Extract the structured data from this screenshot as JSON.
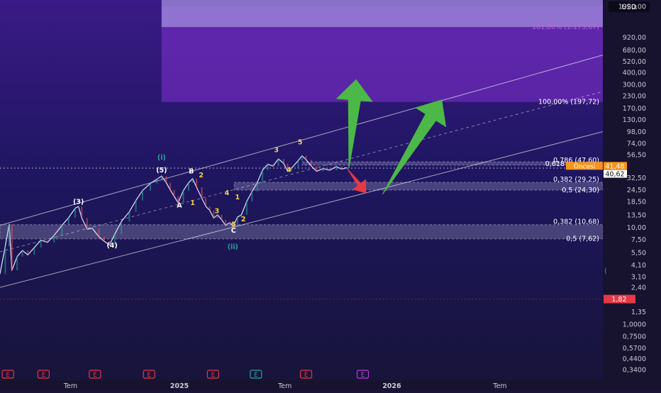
{
  "chart_data": {
    "type": "line",
    "scale": "log",
    "currency": "USD",
    "y_ticks": [
      "1920,00",
      "920,00",
      "680,00",
      "520,00",
      "400,00",
      "300,00",
      "230,00",
      "170,00",
      "130,00",
      "98,00",
      "74,00",
      "56,50",
      "32,50",
      "24,50",
      "18,50",
      "13,50",
      "10,00",
      "7,50",
      "5,50",
      "4,10",
      "3,10",
      "2,40",
      "1,35",
      "1,0000",
      "0,7500",
      "0,5700",
      "0,4400",
      "0,3400"
    ],
    "x_ticks": [
      "Tem",
      "2025",
      "Tem",
      "2026",
      "Tem"
    ],
    "price_badges": [
      {
        "label": "41,48",
        "value": 41.48,
        "color": "#f7931a",
        "sub": "Öncesi"
      },
      {
        "label": "40,62",
        "value": 40.62,
        "color": "#ffffff"
      },
      {
        "label": "1,82",
        "value": 1.82,
        "color": "#e53945"
      }
    ],
    "fib_levels": [
      {
        "label": "161,80% (1.173,67)",
        "value": 1173.67
      },
      {
        "label": "100,00% (197,72)",
        "value": 197.72
      },
      {
        "label": "0,786 (47,60)",
        "value": 47.6
      },
      {
        "label": "0,618",
        "value": 44.0
      },
      {
        "label": "0,382 (29,25)",
        "value": 29.25
      },
      {
        "label": "0,5 (24,30)",
        "value": 24.3
      },
      {
        "label": "0,382 (10,68)",
        "value": 10.68
      },
      {
        "label": "0,5 (7,62)",
        "value": 7.62
      }
    ],
    "wave_labels": [
      {
        "text": "(3)",
        "t": 0.119,
        "v": 17.5,
        "color": "#ffffff"
      },
      {
        "text": "(4)",
        "t": 0.17,
        "v": 6.2,
        "color": "#ffffff"
      },
      {
        "text": "(5)",
        "t": 0.245,
        "v": 37.0,
        "color": "#ffffff"
      },
      {
        "text": "(i)",
        "t": 0.245,
        "v": 50.0,
        "color": "#26a69a"
      },
      {
        "text": "A",
        "t": 0.272,
        "v": 16.0,
        "color": "#ffffff"
      },
      {
        "text": "B",
        "t": 0.29,
        "v": 36.0,
        "color": "#ffffff"
      },
      {
        "text": "C",
        "t": 0.354,
        "v": 8.8,
        "color": "#ffffff"
      },
      {
        "text": "(ii)",
        "t": 0.353,
        "v": 6.0,
        "color": "#26a69a"
      },
      {
        "text": "1",
        "t": 0.292,
        "v": 17.0,
        "color": "#f5d142"
      },
      {
        "text": "2",
        "t": 0.305,
        "v": 33.0,
        "color": "#f5d142"
      },
      {
        "text": "3",
        "t": 0.329,
        "v": 14.0,
        "color": "#f5d142"
      },
      {
        "text": "4",
        "t": 0.344,
        "v": 21.5,
        "color": "#f5d142"
      },
      {
        "text": "5",
        "t": 0.354,
        "v": 10.2,
        "color": "#f5d142"
      },
      {
        "text": "1",
        "t": 0.36,
        "v": 19.5,
        "color": "#f5d142"
      },
      {
        "text": "2",
        "t": 0.369,
        "v": 11.6,
        "color": "#f5d142"
      },
      {
        "text": "3",
        "t": 0.419,
        "v": 60.0,
        "color": "#f5d142"
      },
      {
        "text": "4",
        "t": 0.438,
        "v": 37.5,
        "color": "#f5d142"
      },
      {
        "text": "5",
        "t": 0.455,
        "v": 72.0,
        "color": "#f5d142"
      }
    ],
    "event_markers": [
      {
        "label": "E",
        "t": 0.012,
        "color": "#e53945"
      },
      {
        "label": "E",
        "t": 0.066,
        "color": "#e53945"
      },
      {
        "label": "E",
        "t": 0.144,
        "color": "#e53945"
      },
      {
        "label": "E",
        "t": 0.226,
        "color": "#e53945"
      },
      {
        "label": "E",
        "t": 0.323,
        "color": "#e53945"
      },
      {
        "label": "E",
        "t": 0.388,
        "color": "#26a69a"
      },
      {
        "label": "E",
        "t": 0.464,
        "color": "#e53945"
      },
      {
        "label": "E",
        "t": 0.55,
        "color": "#c03ad8"
      }
    ],
    "price_series": [
      {
        "t": 0.0,
        "v": 3.3
      },
      {
        "t": 0.008,
        "v": 6.4
      },
      {
        "t": 0.014,
        "v": 10.8
      },
      {
        "t": 0.018,
        "v": 3.6
      },
      {
        "t": 0.026,
        "v": 5.0
      },
      {
        "t": 0.034,
        "v": 5.8
      },
      {
        "t": 0.042,
        "v": 5.2
      },
      {
        "t": 0.052,
        "v": 6.2
      },
      {
        "t": 0.062,
        "v": 7.4
      },
      {
        "t": 0.072,
        "v": 7.0
      },
      {
        "t": 0.082,
        "v": 8.3
      },
      {
        "t": 0.094,
        "v": 10.5
      },
      {
        "t": 0.104,
        "v": 12.6
      },
      {
        "t": 0.114,
        "v": 15.8
      },
      {
        "t": 0.119,
        "v": 16.5
      },
      {
        "t": 0.124,
        "v": 12.5
      },
      {
        "t": 0.132,
        "v": 9.6
      },
      {
        "t": 0.14,
        "v": 9.8
      },
      {
        "t": 0.15,
        "v": 8.0
      },
      {
        "t": 0.158,
        "v": 7.2
      },
      {
        "t": 0.166,
        "v": 6.6
      },
      {
        "t": 0.174,
        "v": 8.5
      },
      {
        "t": 0.184,
        "v": 11.5
      },
      {
        "t": 0.196,
        "v": 14.5
      },
      {
        "t": 0.206,
        "v": 19.0
      },
      {
        "t": 0.216,
        "v": 24.0
      },
      {
        "t": 0.228,
        "v": 28.5
      },
      {
        "t": 0.238,
        "v": 31.5
      },
      {
        "t": 0.245,
        "v": 34.0
      },
      {
        "t": 0.252,
        "v": 29.0
      },
      {
        "t": 0.258,
        "v": 24.5
      },
      {
        "t": 0.264,
        "v": 21.0
      },
      {
        "t": 0.27,
        "v": 18.0
      },
      {
        "t": 0.278,
        "v": 24.0
      },
      {
        "t": 0.286,
        "v": 29.0
      },
      {
        "t": 0.292,
        "v": 32.0
      },
      {
        "t": 0.298,
        "v": 26.0
      },
      {
        "t": 0.306,
        "v": 20.0
      },
      {
        "t": 0.312,
        "v": 16.5
      },
      {
        "t": 0.318,
        "v": 15.0
      },
      {
        "t": 0.324,
        "v": 12.5
      },
      {
        "t": 0.33,
        "v": 13.5
      },
      {
        "t": 0.336,
        "v": 12.0
      },
      {
        "t": 0.342,
        "v": 10.5
      },
      {
        "t": 0.348,
        "v": 11.2
      },
      {
        "t": 0.354,
        "v": 10.4
      },
      {
        "t": 0.36,
        "v": 12.8
      },
      {
        "t": 0.366,
        "v": 13.5
      },
      {
        "t": 0.374,
        "v": 18.5
      },
      {
        "t": 0.382,
        "v": 23.5
      },
      {
        "t": 0.39,
        "v": 29.0
      },
      {
        "t": 0.398,
        "v": 39.0
      },
      {
        "t": 0.406,
        "v": 45.0
      },
      {
        "t": 0.414,
        "v": 43.0
      },
      {
        "t": 0.422,
        "v": 51.0
      },
      {
        "t": 0.43,
        "v": 46.0
      },
      {
        "t": 0.436,
        "v": 38.0
      },
      {
        "t": 0.442,
        "v": 41.0
      },
      {
        "t": 0.452,
        "v": 49.0
      },
      {
        "t": 0.458,
        "v": 55.0
      },
      {
        "t": 0.464,
        "v": 50.0
      },
      {
        "t": 0.472,
        "v": 43.0
      },
      {
        "t": 0.48,
        "v": 38.0
      },
      {
        "t": 0.49,
        "v": 40.5
      },
      {
        "t": 0.5,
        "v": 39.0
      },
      {
        "t": 0.51,
        "v": 42.5
      },
      {
        "t": 0.518,
        "v": 40.0
      },
      {
        "t": 0.526,
        "v": 41.5
      }
    ],
    "channel": {
      "upper": {
        "t1": 0.0,
        "v1": 10.5,
        "t2": 0.92,
        "v2": 620.0
      },
      "middle": {
        "t1": 0.0,
        "v1": 5.6,
        "t2": 0.92,
        "v2": 260.0
      },
      "lower": {
        "t1": 0.0,
        "v1": 2.4,
        "t2": 0.92,
        "v2": 100.0
      }
    },
    "target_zone": {
      "v_low": 197.72,
      "v_high": 1920,
      "t_start": 0.245,
      "t_end": 0.93
    },
    "projection_arrows": [
      {
        "color": "#4cb848",
        "from": {
          "t": 0.529,
          "v": 41.0
        },
        "to": {
          "t": 0.54,
          "v": 340.0
        }
      },
      {
        "color": "#4cb848",
        "from": {
          "t": 0.58,
          "v": 22.0
        },
        "to": {
          "t": 0.67,
          "v": 210.0
        }
      },
      {
        "color": "#e53945",
        "from": {
          "t": 0.527,
          "v": 40.0
        },
        "to": {
          "t": 0.555,
          "v": 22.5
        }
      }
    ]
  }
}
